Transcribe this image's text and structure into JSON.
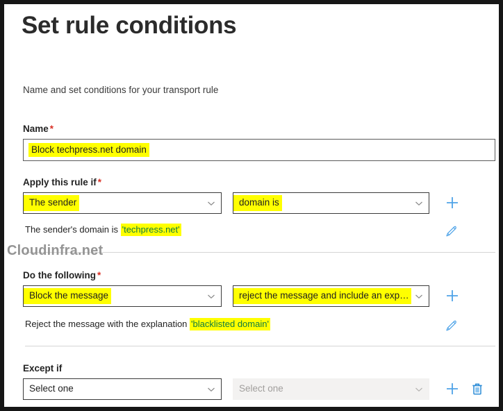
{
  "header": {
    "title": "Set rule conditions",
    "subtitle": "Name and set conditions for your transport rule"
  },
  "watermark": {
    "text": "Cloudinfra.net"
  },
  "colors": {
    "highlight": "#ffff00",
    "quoted_text": "#107c41",
    "required_asterisk": "#d93025",
    "accent_icon": "#4ea3e8",
    "title_text": "#2b2b2b",
    "divider": "#d5d5d5",
    "disabled_field_bg": "#f3f2f1"
  },
  "fields": {
    "name": {
      "label": "Name",
      "required": "*",
      "value": "Block techpress.net domain"
    },
    "apply_if": {
      "label": "Apply this rule if",
      "required": "*",
      "condition_select": "The sender",
      "operator_select": "domain is",
      "add_label": "+",
      "description_prefix": "The sender's domain is ",
      "description_value": "'techpress.net'",
      "edit_label": "edit"
    },
    "do_following": {
      "label": "Do the following",
      "required": "*",
      "action_select": "Block the message",
      "action_detail_select": "reject the message and include an exp…",
      "add_label": "+",
      "description_prefix": "Reject the message with the explanation ",
      "description_value": "'blacklisted domain'",
      "edit_label": "edit"
    },
    "except_if": {
      "label": "Except if",
      "required": "",
      "condition_select": "Select one",
      "operator_select": "Select one",
      "add_label": "+",
      "delete_label": "delete"
    }
  },
  "icons": {
    "chevron_down": "chevron-down-icon",
    "plus": "plus-icon",
    "pencil": "pencil-icon",
    "trash": "trash-icon"
  }
}
